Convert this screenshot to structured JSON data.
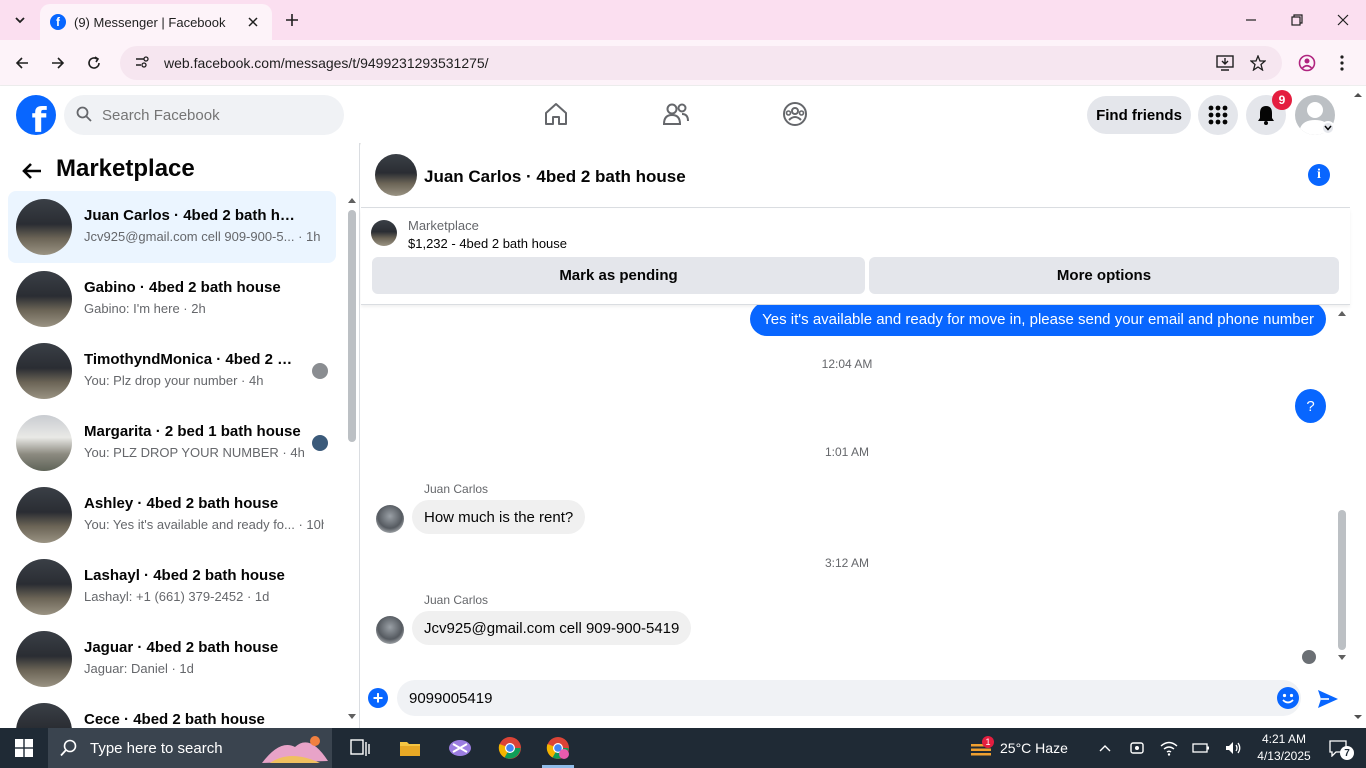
{
  "browser": {
    "tab_title": "(9) Messenger | Facebook",
    "url": "web.facebook.com/messages/t/9499231293531275/"
  },
  "fb_header": {
    "search_placeholder": "Search Facebook",
    "find_friends": "Find friends",
    "notification_count": "9"
  },
  "sidebar": {
    "title": "Marketplace",
    "conversations": [
      {
        "name": "Juan Carlos · 4bed 2 bath house",
        "preview": "Jcv925@gmail.com cell 909-900-5... · 1h",
        "active": true
      },
      {
        "name": "Gabino · 4bed 2 bath house",
        "preview": "Gabino: I'm here · 2h"
      },
      {
        "name": "TimothyndMonica · 4bed 2 ba...",
        "preview": "You: Plz drop your number · 4h"
      },
      {
        "name": "Margarita · 2 bed 1 bath house",
        "preview": "You: PLZ DROP YOUR NUMBER · 4h"
      },
      {
        "name": "Ashley · 4bed 2 bath house",
        "preview": "You: Yes it's available and ready fo... · 10h"
      },
      {
        "name": "Lashayl · 4bed 2 bath house",
        "preview": "Lashayl: +1 (661) 379-2452 · 1d"
      },
      {
        "name": "Jaguar · 4bed 2 bath house",
        "preview": "Jaguar: Daniel · 1d"
      },
      {
        "name": "Cece · 4bed 2 bath house",
        "preview": ""
      }
    ]
  },
  "chat": {
    "title": "Juan Carlos · 4bed 2 bath house",
    "listing_category": "Marketplace",
    "listing_price": "$1,232 - 4bed 2 bath house",
    "mark_pending": "Mark as pending",
    "more_options": "More options",
    "messages": {
      "out1": "Yes it's available and ready for move in, please send your email and phone number",
      "ts1": "12:04 AM",
      "out2": "?",
      "ts2": "1:01 AM",
      "sender1": "Juan Carlos",
      "in1": "How much is the rent?",
      "ts3": "3:12 AM",
      "sender2": "Juan Carlos",
      "in2": "Jcv925@gmail.com cell 909-900-5419"
    },
    "composer_value": "9099005419"
  },
  "taskbar": {
    "search_placeholder": "Type here to search",
    "weather": "25°C  Haze",
    "weather_badge": "1",
    "time": "4:21 AM",
    "date": "4/13/2025",
    "notif_count": "7"
  },
  "colors": {
    "fb_blue": "#0866ff",
    "tab_pink": "#fbdff0",
    "badge_red": "#e41e3f"
  }
}
